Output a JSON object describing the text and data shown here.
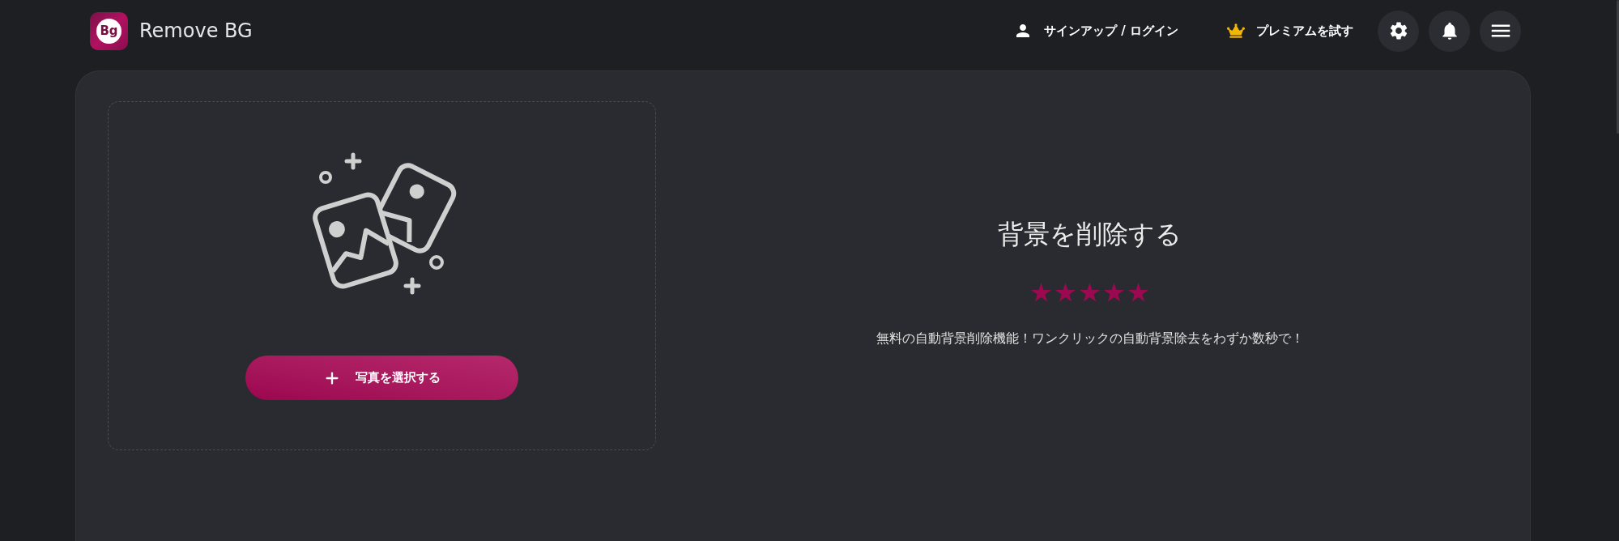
{
  "header": {
    "logo_text": "Bg",
    "brand": "Remove BG",
    "nav": [
      {
        "kind": "account",
        "label": "サインアップ / ログイン"
      },
      {
        "kind": "premium",
        "label": "プレミアムを試す"
      }
    ]
  },
  "upload": {
    "button": "写真を選択する"
  },
  "hero": {
    "title": "背景を削除する",
    "stars": 5,
    "description": "無料の自動背景削除機能！ワンクリックの自動背景除去をわずか数秒で！"
  }
}
